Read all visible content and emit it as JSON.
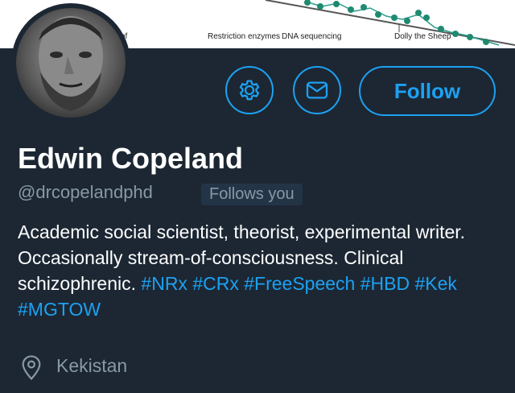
{
  "banner": {
    "labels": [
      "Restriction enzymes",
      "DNA sequencing",
      "Dolly the Sheep"
    ],
    "partial_left_label": "of"
  },
  "profile": {
    "name": "Edwin Copeland",
    "handle": "@drcopelandphd",
    "follows_you": "Follows you",
    "bio_text_1": "Academic social scientist, theorist, experimental writer. Occasionally stream-of-consciousness. Clinical schizophrenic. ",
    "hashtags": [
      "#NRx",
      "#CRx",
      "#FreeSpeech",
      "#HBD",
      "#Kek",
      "#MGTOW"
    ],
    "location": "Kekistan"
  },
  "actions": {
    "settings_icon": "gear-icon",
    "message_icon": "envelope-icon",
    "follow_label": "Follow"
  },
  "colors": {
    "background": "#1c2733",
    "accent": "#1da1f2",
    "secondary_text": "#8899a6",
    "primary_text": "#ffffff"
  }
}
